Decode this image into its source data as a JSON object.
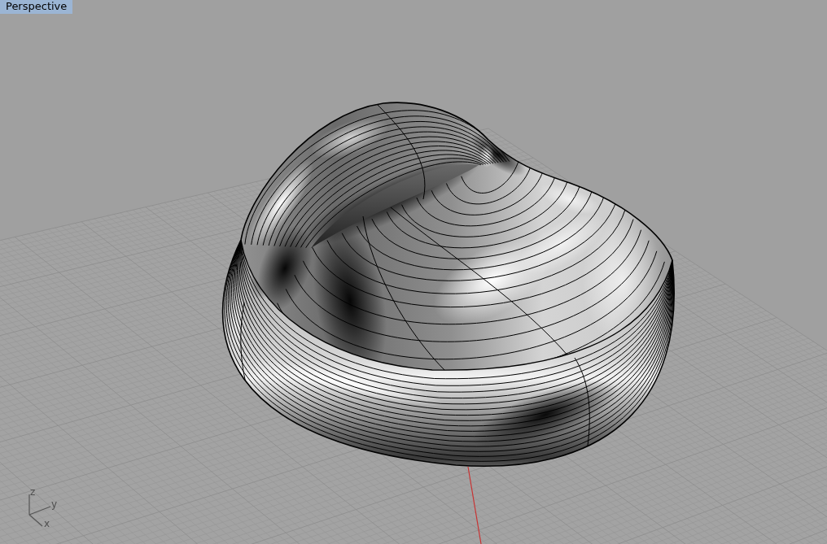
{
  "viewport": {
    "title": "Perspective",
    "active": true
  },
  "axis_triad": [
    {
      "label": "z"
    },
    {
      "label": "y"
    },
    {
      "label": "x"
    }
  ]
}
